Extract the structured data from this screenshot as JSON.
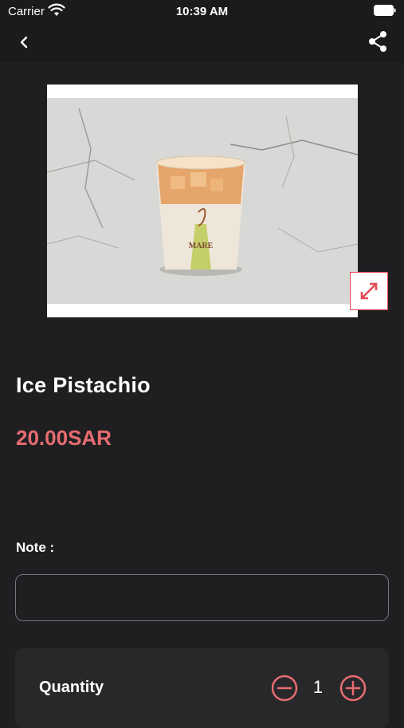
{
  "status_bar": {
    "carrier": "Carrier",
    "time": "10:39 AM"
  },
  "product": {
    "name": "Ice Pistachio",
    "price": "20.00SAR"
  },
  "note": {
    "label": "Note :",
    "value": "",
    "placeholder": ""
  },
  "quantity": {
    "label": "Quantity",
    "value": "1"
  },
  "colors": {
    "accent": "#e76c70",
    "background": "#1f1f22",
    "card": "#28282b"
  },
  "icons": [
    "wifi-icon",
    "battery-icon",
    "back-chevron-icon",
    "share-icon",
    "expand-icon",
    "minus-circle-icon",
    "plus-circle-icon"
  ]
}
